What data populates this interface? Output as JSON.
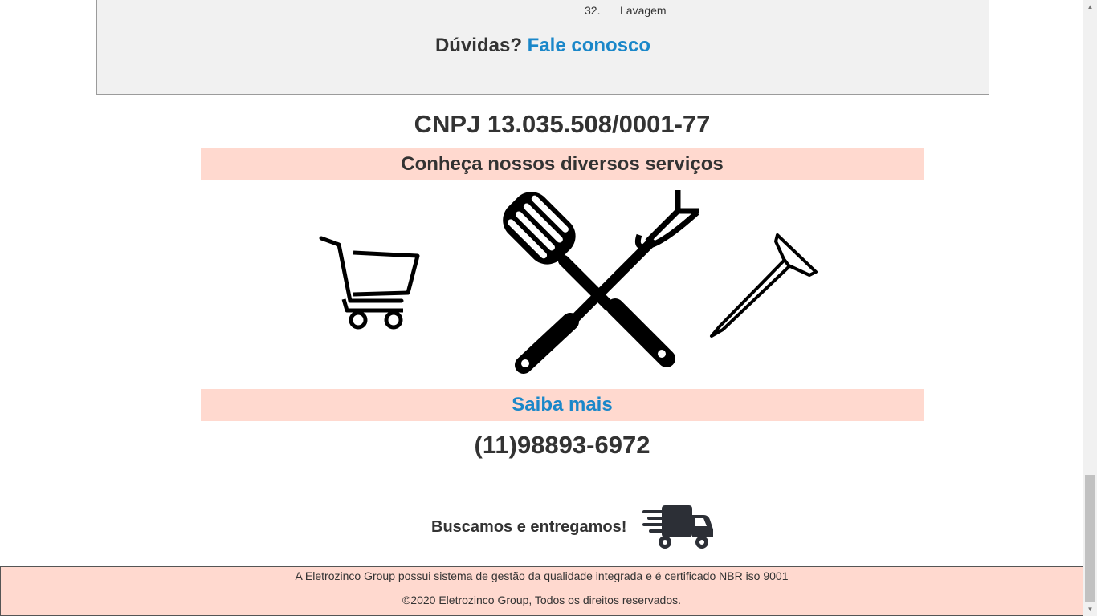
{
  "faq": {
    "item_number": "32.",
    "item_label": "Lavagem",
    "question": "Dúvidas?",
    "contact_link": "Fale conosco"
  },
  "cnpj": "CNPJ 13.035.508/0001-77",
  "services": {
    "heading": "Conheça nossos diversos serviços",
    "icons": [
      "shopping-cart-icon",
      "bbq-tools-icon",
      "nail-icon"
    ],
    "more_link": "Saiba mais"
  },
  "phone": "(11)98893-6972",
  "delivery": {
    "text": "Buscamos e entregamos!",
    "icon": "delivery-truck-icon"
  },
  "footer": {
    "quality": "A Eletrozinco Group possui sistema de gestão da qualidade integrada e é certificado NBR iso 9001",
    "copyright": "©2020 Eletrozinco Group, Todos os direitos reservados."
  },
  "colors": {
    "accent_link": "#1a87c9",
    "band_background": "#ffd9cf",
    "text": "#333333",
    "faq_background": "#f1f1f1"
  }
}
